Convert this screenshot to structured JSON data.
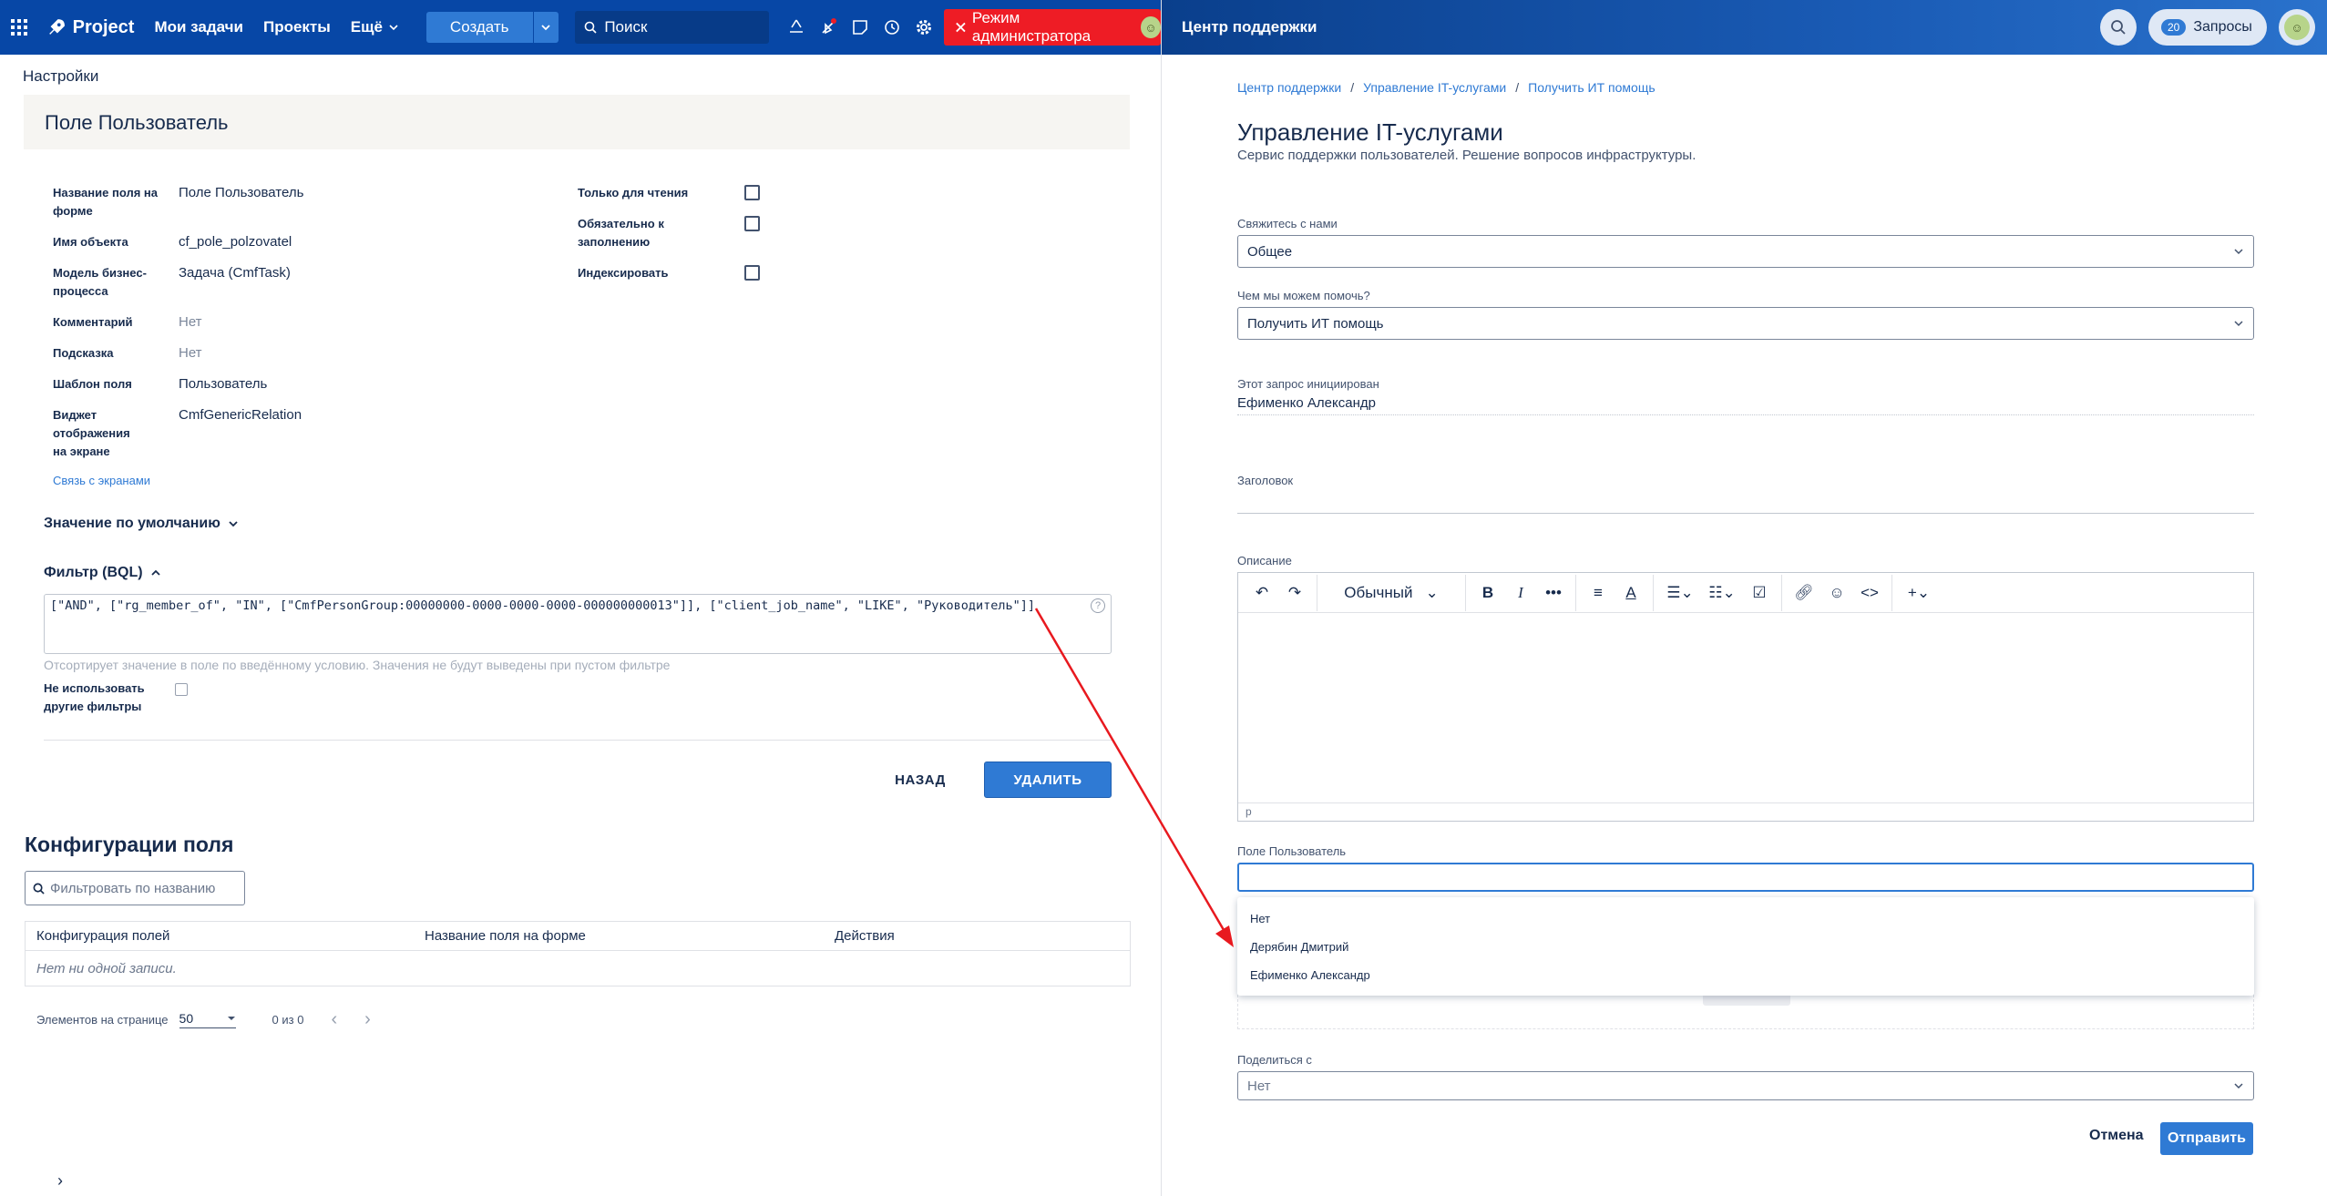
{
  "topbar": {
    "logo": "Project",
    "nav": [
      "Мои задачи",
      "Проекты",
      "Ещё"
    ],
    "create": "Создать",
    "search": "Поиск",
    "admin": "Режим администратора"
  },
  "left": {
    "breadcrumb": "Настройки",
    "panel_title": "Поле Пользователь",
    "props": [
      {
        "k": "Название поля на форме",
        "v": "Поле Пользователь"
      },
      {
        "k": "Имя объекта",
        "v": "cf_pole_polzovatel"
      },
      {
        "k": "Модель бизнес-процесса",
        "v": "Задача (CmfTask)"
      },
      {
        "k": "Комментарий",
        "v": "Нет"
      },
      {
        "k": "Подсказка",
        "v": "Нет"
      },
      {
        "k": "Шаблон поля",
        "v": "Пользователь"
      },
      {
        "k": "Виджет отображения на экране",
        "v": "CmfGenericRelation"
      }
    ],
    "screens_link": "Связь с экранами",
    "checks": [
      "Только для чтения",
      "Обязательно к заполнению",
      "Индексировать"
    ],
    "default_value": "Значение по умолчанию",
    "filter_label": "Фильтр (BQL)",
    "bql": "[\"AND\", [\"rg_member_of\", \"IN\", [\"CmfPersonGroup:00000000-0000-0000-0000-000000000013\"]], [\"client_job_name\", \"LIKE\", \"Руководитель\"]]",
    "bql_hint": "Отсортирует значение в поле по введённому условию. Значения не будут выведены при пустом фильтре",
    "no_other_filters": "Не использовать другие фильтры",
    "back": "НАЗАД",
    "delete": "УДАЛИТЬ",
    "config_title": "Конфигурации поля",
    "config_filter_placeholder": "Фильтровать по названию",
    "table_headers": [
      "Конфигурация полей",
      "Название поля на форме",
      "Действия"
    ],
    "table_empty": "Нет ни одной записи.",
    "per_page_label": "Элементов на странице",
    "per_page": "50",
    "count": "0 из 0"
  },
  "portal": {
    "title": "Центр поддержки",
    "requests_count": "20",
    "requests_label": "Запросы",
    "crumbs": [
      "Центр поддержки",
      "Управление IT-услугами",
      "Получить ИТ помощь"
    ],
    "service_title": "Управление IT-услугами",
    "service_sub": "Сервис поддержки пользователей. Решение вопросов инфраструктуры.",
    "contact_label": "Свяжитесь с нами",
    "contact_value": "Общее",
    "help_label": "Чем мы можем помочь?",
    "help_value": "Получить ИТ помощь",
    "initiated_label": "Этот запрос инициирован",
    "initiated_value": "Ефименко Александр",
    "heading_label": "Заголовок",
    "desc_label": "Описание",
    "editor_style": "Обычный",
    "editor_status": "p",
    "user_field_label": "Поле Пользователь",
    "dropdown": [
      "Нет",
      "Дерябин Дмитрий",
      "Ефименко Александр"
    ],
    "share_label": "Поделиться с",
    "share_value": "Нет",
    "cancel": "Отмена",
    "send": "Отправить"
  },
  "colors": {
    "brand": "#0747a6",
    "accent": "#2f7ad4",
    "admin": "#ee1c25",
    "arrow": "#e8191f"
  }
}
